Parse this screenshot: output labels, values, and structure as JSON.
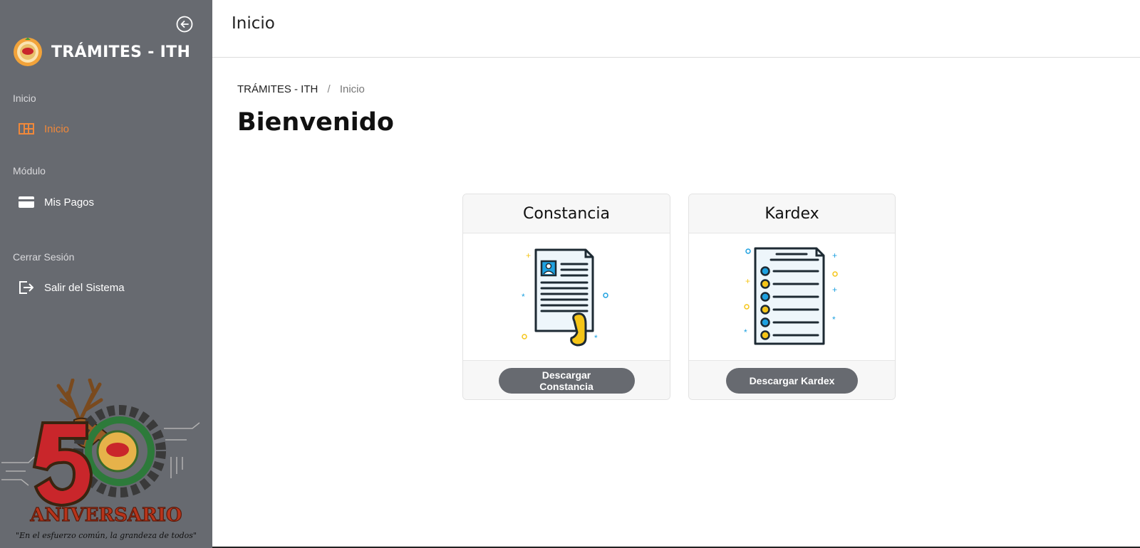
{
  "sidebar": {
    "brand_title": "TRÁMITES - ITH",
    "sections": [
      {
        "label": "Inicio",
        "items": [
          {
            "label": "Inicio",
            "icon": "dashboard-icon",
            "active": true
          }
        ]
      },
      {
        "label": "Módulo",
        "items": [
          {
            "label": "Mis Pagos",
            "icon": "credit-card-icon"
          }
        ]
      },
      {
        "label": "Cerrar Sesión",
        "items": [
          {
            "label": "Salir del Sistema",
            "icon": "logout-icon"
          }
        ]
      }
    ],
    "anniversary": {
      "number": "50",
      "title": "ANIVERSARIO",
      "motto": "\"En el esfuerzo común, la grandeza de todos\""
    }
  },
  "topbar": {
    "title": "Inicio"
  },
  "breadcrumb": {
    "root": "TRÁMITES - ITH",
    "separator": "/",
    "current": "Inicio"
  },
  "page": {
    "heading": "Bienvenido"
  },
  "cards": [
    {
      "title": "Constancia",
      "icon": "certificate-document-icon",
      "button": "Descargar Constancia"
    },
    {
      "title": "Kardex",
      "icon": "list-document-icon",
      "button": "Descargar Kardex"
    }
  ],
  "colors": {
    "sidebar_bg": "#676a70",
    "accent": "#f0883a",
    "button_bg": "#676a70"
  }
}
